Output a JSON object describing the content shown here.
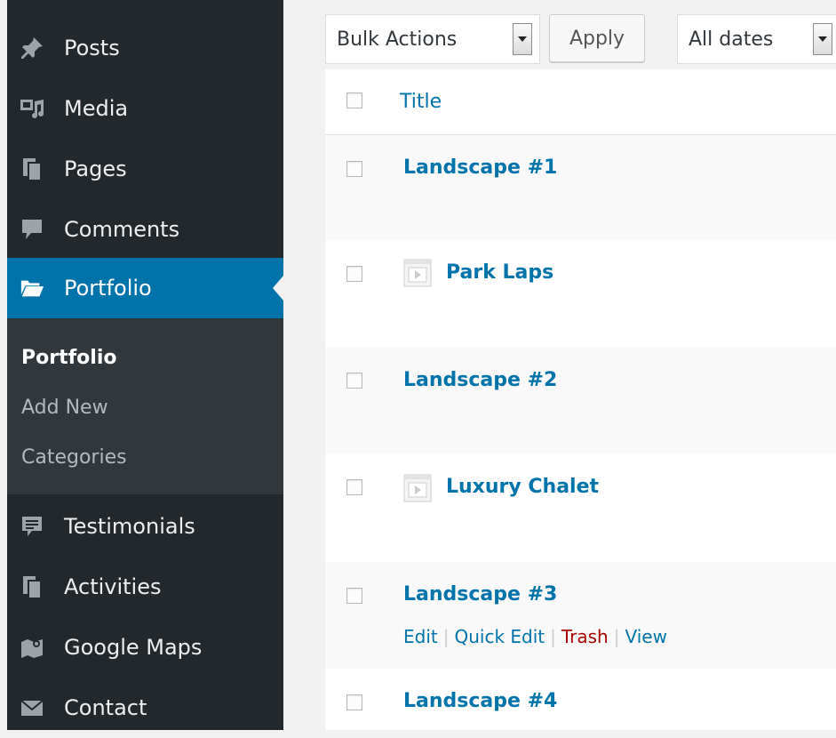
{
  "sidebar": {
    "items": [
      {
        "label": "Posts",
        "icon": "pushpin-icon"
      },
      {
        "label": "Media",
        "icon": "media-icon"
      },
      {
        "label": "Pages",
        "icon": "pages-icon"
      },
      {
        "label": "Comments",
        "icon": "comment-icon"
      },
      {
        "label": "Portfolio",
        "icon": "folder-open-icon",
        "active": true
      },
      {
        "label": "Testimonials",
        "icon": "testimonial-icon"
      },
      {
        "label": "Activities",
        "icon": "pages-icon"
      },
      {
        "label": "Google Maps",
        "icon": "map-icon"
      },
      {
        "label": "Contact",
        "icon": "envelope-icon"
      }
    ],
    "submenu": [
      {
        "label": "Portfolio",
        "current": true
      },
      {
        "label": "Add New"
      },
      {
        "label": "Categories"
      }
    ]
  },
  "toolbar": {
    "bulk_actions": "Bulk Actions",
    "apply": "Apply",
    "dates": "All dates"
  },
  "table": {
    "header": "Title",
    "rows": [
      {
        "title": "Landscape #1",
        "video": false
      },
      {
        "title": "Park Laps",
        "video": true
      },
      {
        "title": "Landscape #2",
        "video": false
      },
      {
        "title": "Luxury Chalet",
        "video": true
      },
      {
        "title": "Landscape #3",
        "video": false,
        "actions": [
          "Edit",
          "Quick Edit",
          "Trash",
          "View"
        ]
      },
      {
        "title": "Landscape #4",
        "video": false
      }
    ]
  },
  "colors": {
    "sidebar_bg": "#23282d",
    "submenu_bg": "#32373c",
    "active_bg": "#0073aa",
    "link": "#0073aa",
    "trash": "#aa0000"
  }
}
